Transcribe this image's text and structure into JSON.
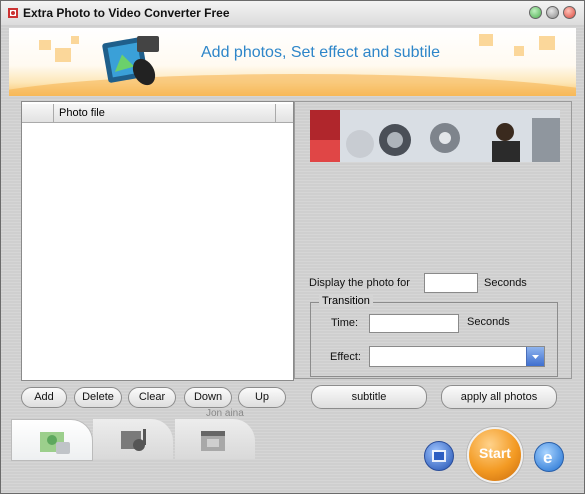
{
  "window": {
    "title": "Extra Photo to Video Converter Free"
  },
  "banner": {
    "text": "Add photos, Set effect and subtile"
  },
  "file_list": {
    "columns": [
      "",
      "Photo file",
      ""
    ]
  },
  "settings": {
    "display_label": "Display the photo for",
    "display_value": "",
    "display_unit": "Seconds",
    "transition_title": "Transition",
    "time_label": "Time:",
    "time_value": "",
    "time_unit": "Seconds",
    "effect_label": "Effect:",
    "effect_value": ""
  },
  "list_buttons": [
    "Add",
    "Delete",
    "Clear",
    "Down",
    "Up"
  ],
  "subtitle_button": "subtitle",
  "apply_button": "apply all photos",
  "start_button": "Start",
  "partial_text": "Jon aina",
  "colors": {
    "banner_text": "#2e86c9",
    "start_orange": "#f39a23",
    "close_red": "#d9473d",
    "min_green": "#5cb85c"
  }
}
